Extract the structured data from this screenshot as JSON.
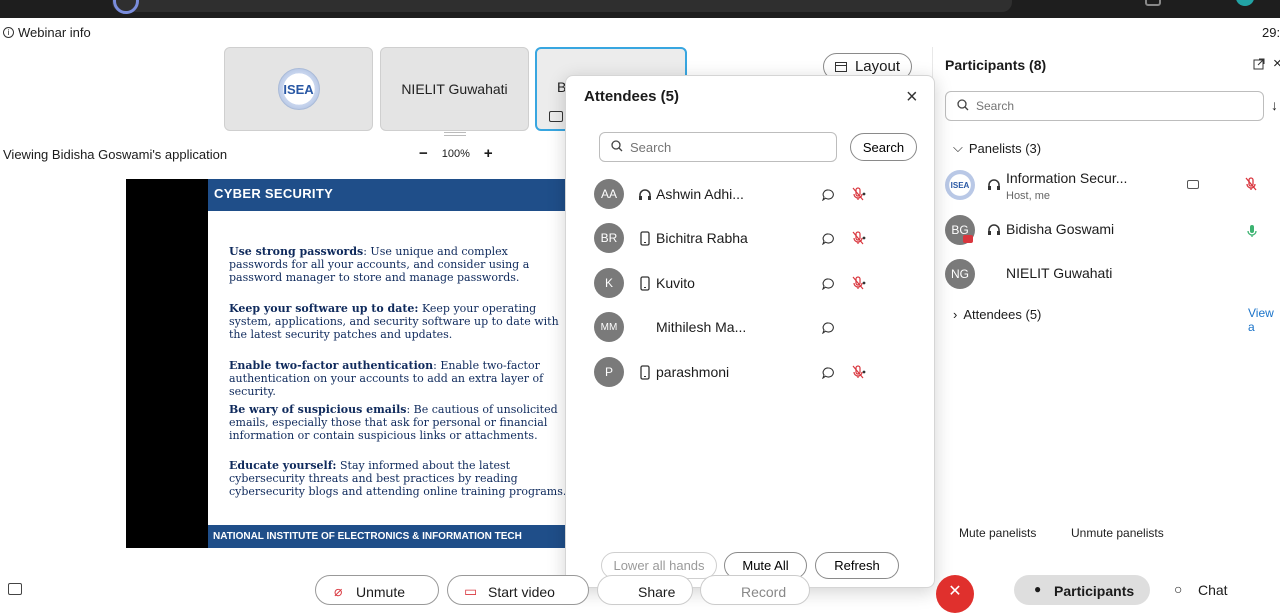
{
  "header": {
    "webinar_info": "Webinar info",
    "clock": "29:"
  },
  "stage": {
    "tiles": [
      {
        "label": "ISEA",
        "kind": "logo"
      },
      {
        "label": "NIELIT Guwahati",
        "kind": "text"
      },
      {
        "label": "B",
        "kind": "selected"
      }
    ],
    "layout_label": "Layout",
    "viewing_text": "Viewing Bidisha Goswami's application",
    "zoom_minus": "−",
    "zoom_value": "100%",
    "zoom_plus": "+"
  },
  "slide": {
    "title": "CYBER SECURITY",
    "footer": "NATIONAL INSTITUTE OF ELECTRONICS & INFORMATION TECH",
    "points": [
      {
        "head": "Use strong passwords",
        "body": ": Use unique and complex passwords for all your accounts, and consider using a password manager to store and manage passwords."
      },
      {
        "head": "Keep your software up to date:",
        "body": " Keep your operating system, applications, and security software up to date with the latest security patches and updates."
      },
      {
        "head": "Enable two-factor authentication",
        "body": ": Enable two-factor authentication on your accounts to add an extra layer of security."
      },
      {
        "head": "Be wary of suspicious emails",
        "body": ": Be cautious of unsolicited emails, especially those that ask for personal or financial information or contain suspicious links or attachments."
      },
      {
        "head": "Educate yourself:",
        "body": " Stay informed about the latest cybersecurity threats and best practices by reading cybersecurity blogs and attending online training programs."
      }
    ]
  },
  "attendees_modal": {
    "title": "Attendees (5)",
    "search_placeholder": "Search",
    "search_button": "Search",
    "rows": [
      {
        "initials": "AA",
        "name": "Ashwin Adhi...",
        "device": "headset-icon",
        "muted": true
      },
      {
        "initials": "BR",
        "name": "Bichitra Rabha",
        "device": "phone-icon",
        "muted": true
      },
      {
        "initials": "K",
        "name": "Kuvito",
        "device": "phone-icon",
        "muted": true
      },
      {
        "initials": "MM",
        "name": "Mithilesh Ma...",
        "device": "",
        "muted": false
      },
      {
        "initials": "P",
        "name": "parashmoni",
        "device": "phone-icon",
        "muted": true
      }
    ],
    "lower_hands": "Lower all hands",
    "mute_all": "Mute All",
    "refresh": "Refresh"
  },
  "participants": {
    "title": "Participants (8)",
    "search_placeholder": "Search",
    "panelists_label": "Panelists (3)",
    "panelists": [
      {
        "initials": "ISEA",
        "name": "Information Secur...",
        "sub": "Host, me"
      },
      {
        "initials": "BG",
        "name": "Bidisha Goswami",
        "sub": ""
      },
      {
        "initials": "NG",
        "name": "NIELIT Guwahati",
        "sub": ""
      }
    ],
    "attendees_label": "Attendees (5)",
    "view_all": "View a",
    "mute_panelists": "Mute panelists",
    "unmute_panelists": "Unmute panelists"
  },
  "toolbar": {
    "unmute": "Unmute",
    "start_video": "Start video",
    "share": "Share",
    "record": "Record",
    "participants": "Participants",
    "chat": "Chat"
  },
  "colors": {
    "accent": "#38a6e0",
    "slide_header": "#1f4e89",
    "end_call": "#e0302d",
    "muted_red": "#d9363e",
    "avatar_gray": "#7a7a7a"
  }
}
